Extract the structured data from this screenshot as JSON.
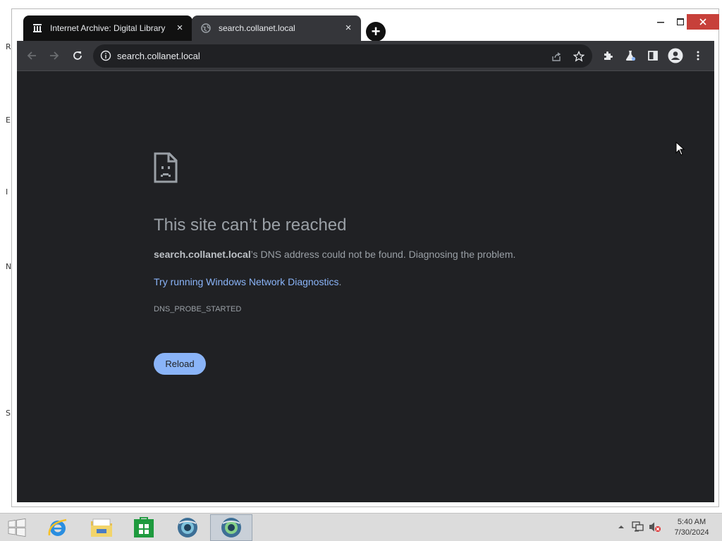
{
  "desktop": {
    "edge_glyphs": [
      "R",
      "E",
      "I",
      "N",
      "S"
    ]
  },
  "tabs": [
    {
      "title": "Internet Archive: Digital Library",
      "icon": "archive-icon",
      "close": "×",
      "active": false
    },
    {
      "title": "search.collanet.local",
      "icon": "globe-icon",
      "close": "×",
      "active": true
    }
  ],
  "new_tab_label": "+",
  "window_controls": {
    "minimize": "–",
    "maximize": "☐",
    "close": "✕"
  },
  "omnibox": {
    "url": "search.collanet.local",
    "icon": "info-icon"
  },
  "error": {
    "title": "This site can’t be reached",
    "host": "search.collanet.local",
    "description_suffix": "’s DNS address could not be found. Diagnosing the problem.",
    "link_text": "Try running Windows Network Diagnostics",
    "link_suffix": ".",
    "code": "DNS_PROBE_STARTED",
    "reload_label": "Reload"
  },
  "taskbar": {
    "items": [
      "start-button",
      "internet-explorer",
      "file-explorer",
      "store",
      "browser-1",
      "browser-2"
    ],
    "clock": {
      "time": "5:40 AM",
      "date": "7/30/2024"
    }
  },
  "colors": {
    "page_bg": "#202124",
    "toolbar_bg": "#35363a",
    "link": "#8ab4f8",
    "reload_bg": "#8ab4f8",
    "close_button": "#c7403a"
  }
}
